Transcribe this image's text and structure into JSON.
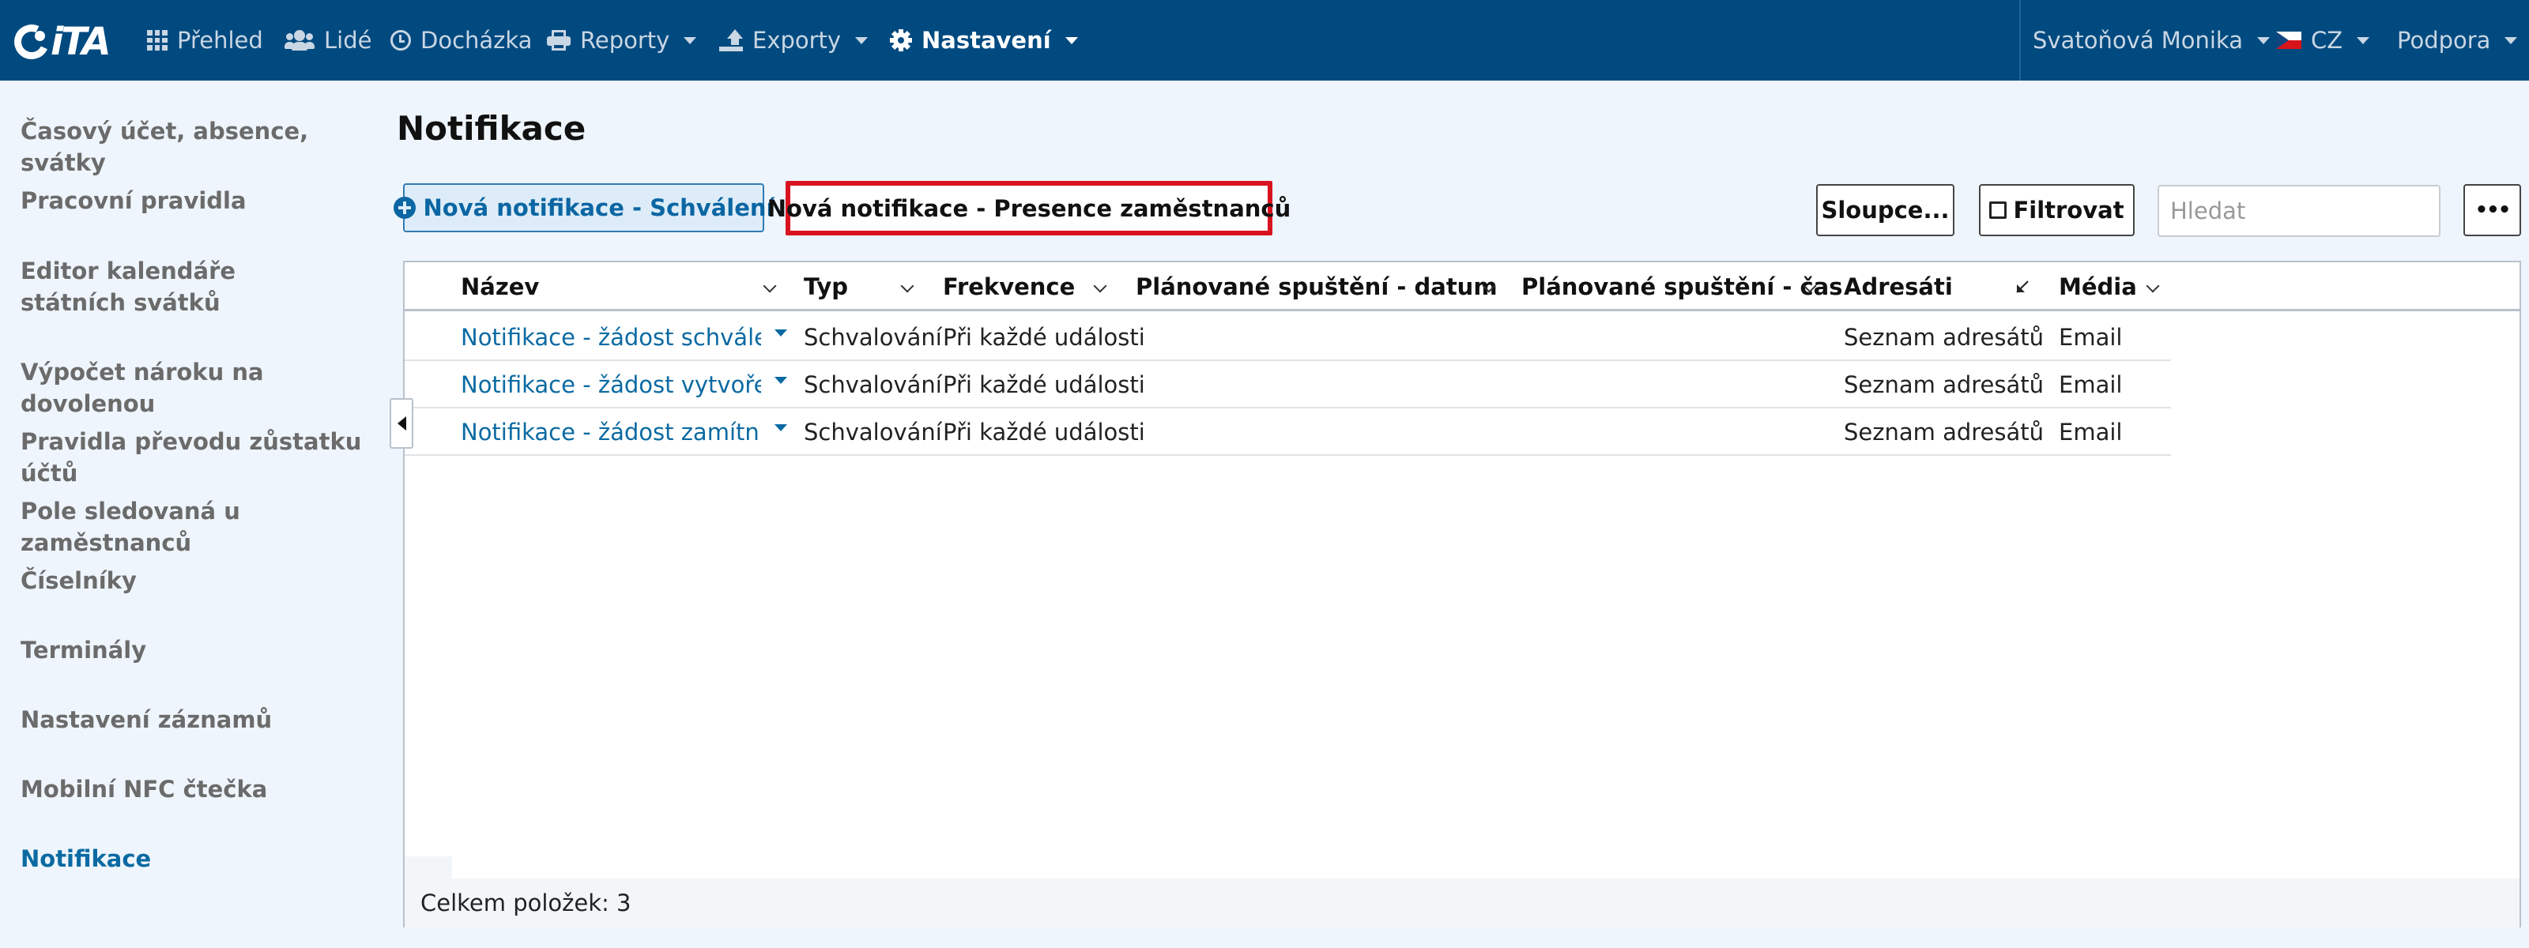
{
  "app": {
    "logo_text": "iTA"
  },
  "nav": {
    "prehled": "Přehled",
    "lide": "Lidé",
    "dochazka": "Docházka",
    "reporty": "Reporty",
    "exporty": "Exporty",
    "nastaveni": "Nastavení",
    "user": "Svatoňová Monika",
    "language": "CZ",
    "support": "Podpora"
  },
  "sidebar": {
    "items": [
      {
        "label": "Časový účet, absence, svátky"
      },
      {
        "label": "Pracovní pravidla"
      },
      {
        "label": "Editor kalendáře státních svátků"
      },
      {
        "label": "Výpočet nároku na dovolenou"
      },
      {
        "label": "Pravidla převodu zůstatku účtů"
      },
      {
        "label": "Pole sledovaná u zaměstnanců"
      },
      {
        "label": "Číselníky"
      },
      {
        "label": "Terminály"
      },
      {
        "label": "Nastavení záznamů"
      },
      {
        "label": "Mobilní NFC čtečka"
      },
      {
        "label": "Notifikace"
      }
    ],
    "active": "Notifikace"
  },
  "main": {
    "title": "Notifikace",
    "toolbar": {
      "new_approval": "Nová notifikace - Schválení",
      "new_presence": "Nová notifikace - Presence zaměstnanců",
      "columns": "Sloupce...",
      "filter": "Filtrovat",
      "search_placeholder": "Hledat",
      "more": "•••"
    },
    "table": {
      "columns": [
        "Název",
        "Typ",
        "Frekvence",
        "Plánované spuštění - datum",
        "Plánované spuštění - čas",
        "Adresáti",
        "Média"
      ],
      "rows": [
        {
          "name": "Notifikace - žádost schvále...",
          "type": "Schvalování",
          "frequency": "Při každé události",
          "date": "",
          "time": "",
          "recipients": "Seznam adresátů",
          "media": "Email"
        },
        {
          "name": "Notifikace - žádost vytvořena",
          "type": "Schvalování",
          "frequency": "Při každé události",
          "date": "",
          "time": "",
          "recipients": "Seznam adresátů",
          "media": "Email"
        },
        {
          "name": "Notifikace - žádost zamítnu...",
          "type": "Schvalování",
          "frequency": "Při každé události",
          "date": "",
          "time": "",
          "recipients": "Seznam adresátů",
          "media": "Email"
        }
      ],
      "footer": "Celkem položek: 3"
    }
  },
  "colors": {
    "topbar": "#004a80",
    "accent": "#0b6aa2",
    "highlight_border": "#d9121f",
    "background": "#eef5fc"
  },
  "icons": {
    "prehled": "grid-icon",
    "lide": "people-icon",
    "dochazka": "clock-icon",
    "reporty": "print-icon",
    "exporty": "export-icon",
    "nastaveni": "gear-icon",
    "language": "czech-flag-icon"
  }
}
